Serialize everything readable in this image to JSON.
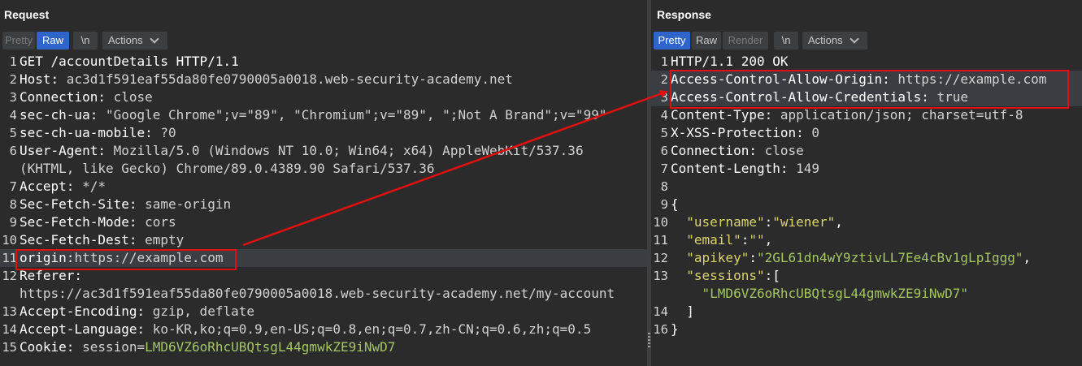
{
  "request": {
    "title": "Request",
    "toolbar": {
      "pretty": "Pretty",
      "raw": "Raw",
      "newline": "\\n",
      "actions": "Actions",
      "active": "Raw"
    },
    "lines": [
      {
        "n": "1",
        "parts": [
          {
            "t": "GET /accountDetails HTTP/1.1",
            "c": "k"
          }
        ]
      },
      {
        "n": "2",
        "parts": [
          {
            "t": "Host:",
            "c": "k"
          },
          {
            "t": " ac3d1f591eaf55da80fe0790005a0018.web-security-academy.net",
            "c": "v"
          }
        ]
      },
      {
        "n": "3",
        "parts": [
          {
            "t": "Connection:",
            "c": "k"
          },
          {
            "t": " close",
            "c": "v"
          }
        ]
      },
      {
        "n": "4",
        "parts": [
          {
            "t": "sec-ch-ua:",
            "c": "k"
          },
          {
            "t": " \"Google Chrome\";v=\"89\", \"Chromium\";v=\"89\", \";Not A Brand\";v=\"99\"",
            "c": "v"
          }
        ]
      },
      {
        "n": "5",
        "parts": [
          {
            "t": "sec-ch-ua-mobile:",
            "c": "k"
          },
          {
            "t": " ?0",
            "c": "v"
          }
        ]
      },
      {
        "n": "6",
        "parts": [
          {
            "t": "User-Agent:",
            "c": "k"
          },
          {
            "t": " Mozilla/5.0 (Windows NT 10.0; Win64; x64) AppleWebKit/537.36",
            "c": "v"
          }
        ]
      },
      {
        "n": "",
        "parts": [
          {
            "t": "(KHTML, like Gecko) Chrome/89.0.4389.90 Safari/537.36",
            "c": "v"
          }
        ]
      },
      {
        "n": "7",
        "parts": [
          {
            "t": "Accept:",
            "c": "k"
          },
          {
            "t": " */*",
            "c": "v"
          }
        ]
      },
      {
        "n": "8",
        "parts": [
          {
            "t": "Sec-Fetch-Site:",
            "c": "k"
          },
          {
            "t": " same-origin",
            "c": "v"
          }
        ]
      },
      {
        "n": "9",
        "parts": [
          {
            "t": "Sec-Fetch-Mode:",
            "c": "k"
          },
          {
            "t": " cors",
            "c": "v"
          }
        ]
      },
      {
        "n": "10",
        "parts": [
          {
            "t": "Sec-Fetch-Dest:",
            "c": "k"
          },
          {
            "t": " empty",
            "c": "v"
          }
        ]
      },
      {
        "n": "11",
        "hl": true,
        "parts": [
          {
            "t": "origin:",
            "c": "k"
          },
          {
            "t": "https://example.com",
            "c": "v"
          }
        ]
      },
      {
        "n": "12",
        "parts": [
          {
            "t": "Referer:",
            "c": "k"
          }
        ]
      },
      {
        "n": "",
        "parts": [
          {
            "t": "https://ac3d1f591eaf55da80fe0790005a0018.web-security-academy.net/my-account",
            "c": "v"
          }
        ]
      },
      {
        "n": "13",
        "parts": [
          {
            "t": "Accept-Encoding:",
            "c": "k"
          },
          {
            "t": " gzip, deflate",
            "c": "v"
          }
        ]
      },
      {
        "n": "14",
        "parts": [
          {
            "t": "Accept-Language:",
            "c": "k"
          },
          {
            "t": " ko-KR,ko;q=0.9,en-US;q=0.8,en;q=0.7,zh-CN;q=0.6,zh;q=0.5",
            "c": "v"
          }
        ]
      },
      {
        "n": "15",
        "parts": [
          {
            "t": "Cookie:",
            "c": "k"
          },
          {
            "t": " session=",
            "c": "v"
          },
          {
            "t": "LMD6VZ6oRhcUBQtsgL44gmwkZE9iNwD7",
            "c": "grn"
          }
        ]
      }
    ]
  },
  "response": {
    "title": "Response",
    "toolbar": {
      "pretty": "Pretty",
      "raw": "Raw",
      "render": "Render",
      "newline": "\\n",
      "actions": "Actions",
      "active": "Pretty"
    },
    "lines": [
      {
        "n": "1",
        "parts": [
          {
            "t": "HTTP/1.1 200 OK",
            "c": "k"
          }
        ]
      },
      {
        "n": "2",
        "hl": true,
        "parts": [
          {
            "t": "Access-Control-Allow-Origin:",
            "c": "k"
          },
          {
            "t": " https://example.com",
            "c": "v"
          }
        ]
      },
      {
        "n": "3",
        "hl": true,
        "parts": [
          {
            "t": "Access-Control-Allow-Credentials:",
            "c": "k"
          },
          {
            "t": " true",
            "c": "v"
          }
        ]
      },
      {
        "n": "4",
        "parts": [
          {
            "t": "Content-Type:",
            "c": "k"
          },
          {
            "t": " application/json; charset=utf-8",
            "c": "v"
          }
        ]
      },
      {
        "n": "5",
        "parts": [
          {
            "t": "X-XSS-Protection:",
            "c": "k"
          },
          {
            "t": " 0",
            "c": "v"
          }
        ]
      },
      {
        "n": "6",
        "parts": [
          {
            "t": "Connection:",
            "c": "k"
          },
          {
            "t": " close",
            "c": "v"
          }
        ]
      },
      {
        "n": "7",
        "parts": [
          {
            "t": "Content-Length:",
            "c": "k"
          },
          {
            "t": " 149",
            "c": "v"
          }
        ]
      },
      {
        "n": "8",
        "parts": []
      },
      {
        "n": "9",
        "parts": [
          {
            "t": "{",
            "c": "k"
          }
        ]
      },
      {
        "n": "10",
        "parts": [
          {
            "t": "  ",
            "c": "k"
          },
          {
            "t": "\"username\"",
            "c": "str"
          },
          {
            "t": ":",
            "c": "k"
          },
          {
            "t": "\"wiener\"",
            "c": "str"
          },
          {
            "t": ",",
            "c": "k"
          }
        ]
      },
      {
        "n": "11",
        "parts": [
          {
            "t": "  ",
            "c": "k"
          },
          {
            "t": "\"email\"",
            "c": "str"
          },
          {
            "t": ":",
            "c": "k"
          },
          {
            "t": "\"\"",
            "c": "str"
          },
          {
            "t": ",",
            "c": "k"
          }
        ]
      },
      {
        "n": "12",
        "parts": [
          {
            "t": "  ",
            "c": "k"
          },
          {
            "t": "\"apikey\"",
            "c": "str"
          },
          {
            "t": ":",
            "c": "k"
          },
          {
            "t": "\"2GL61dn4wY9ztivLL7Ee4cBv1gLpIggg\"",
            "c": "grn"
          },
          {
            "t": ",",
            "c": "k"
          }
        ]
      },
      {
        "n": "13",
        "parts": [
          {
            "t": "  ",
            "c": "k"
          },
          {
            "t": "\"sessions\"",
            "c": "str"
          },
          {
            "t": ":[",
            "c": "k"
          }
        ]
      },
      {
        "n": "",
        "parts": [
          {
            "t": "    ",
            "c": "k"
          },
          {
            "t": "\"LMD6VZ6oRhcUBQtsgL44gmwkZE9iNwD7\"",
            "c": "grn"
          }
        ]
      },
      {
        "n": "14",
        "parts": [
          {
            "t": "  ]",
            "c": "k"
          }
        ]
      },
      {
        "n": "16",
        "parts": [
          {
            "t": "}",
            "c": "k"
          }
        ]
      }
    ]
  },
  "colors": {
    "annotation": "#e01010",
    "active_button": "#2f65ca",
    "background": "#2b2b2b"
  }
}
